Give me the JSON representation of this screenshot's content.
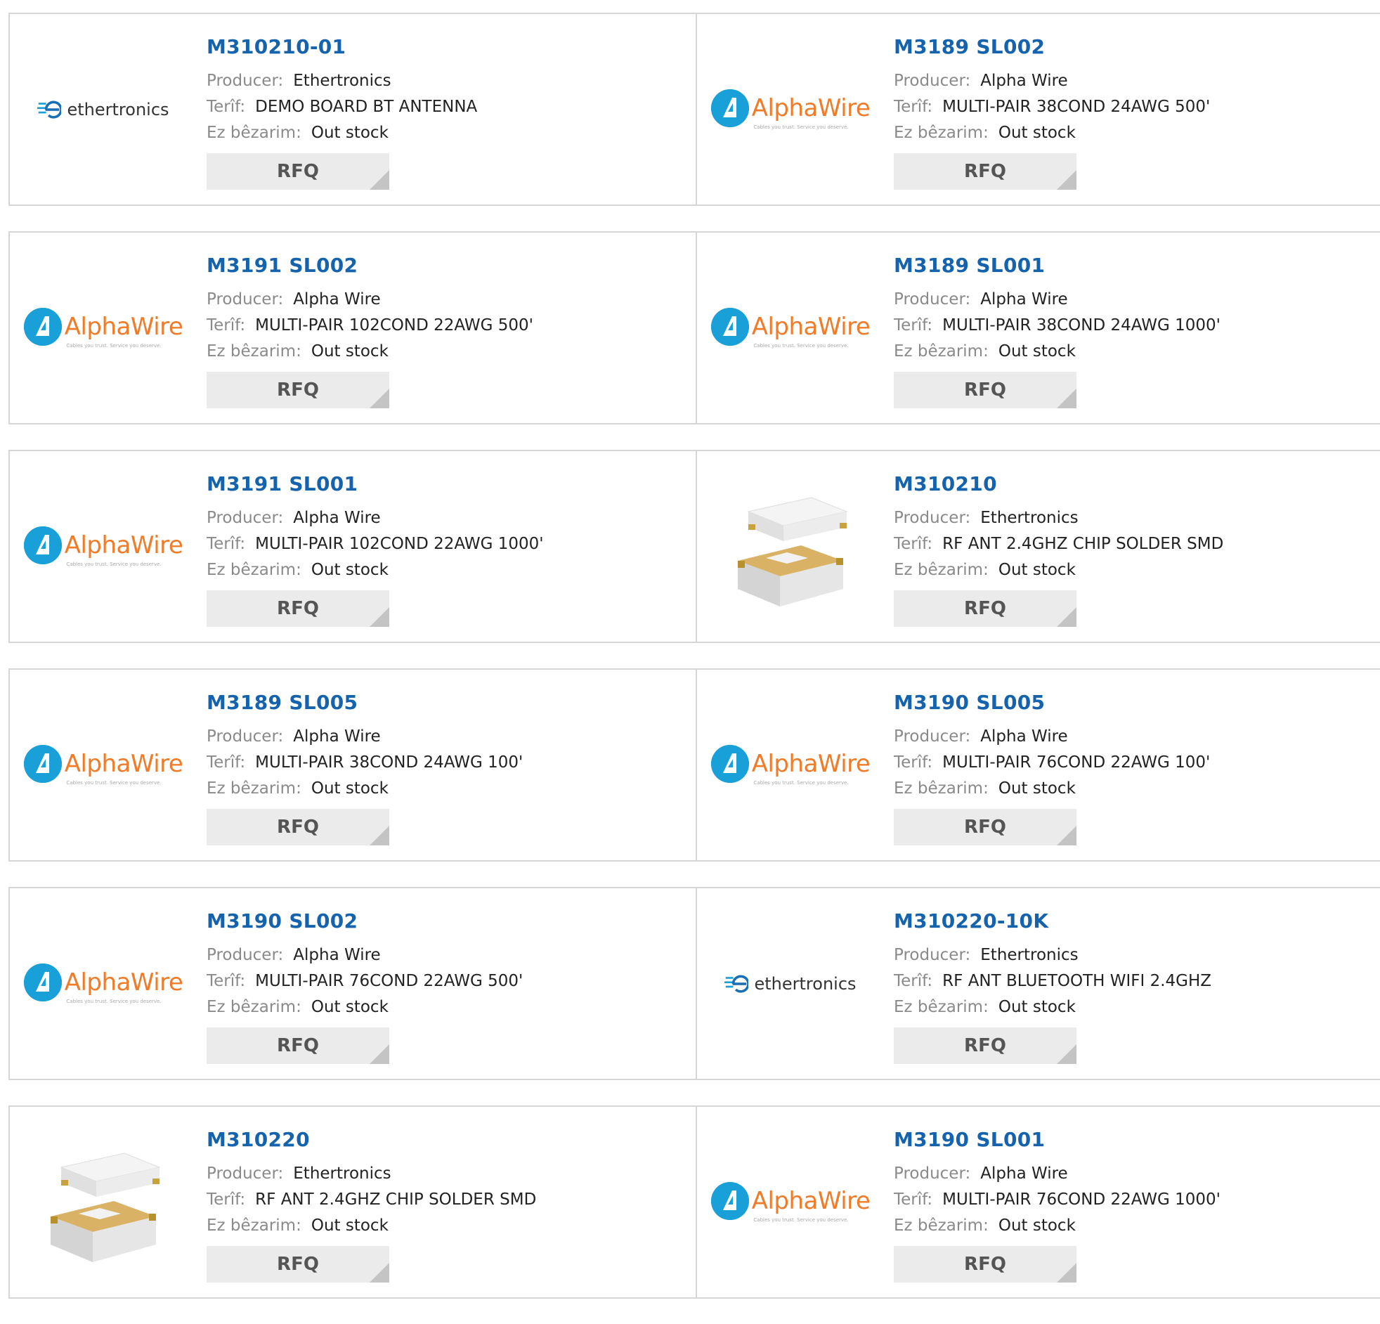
{
  "labels": {
    "producer": "Producer:",
    "description": "Terîf:",
    "stock": "Ez bêzarim:",
    "rfq": "RFQ"
  },
  "products": [
    {
      "part": "M310210-01",
      "producer": "Ethertronics",
      "description": "DEMO BOARD BT ANTENNA",
      "stock": "Out stock",
      "logo": "ethertronics-logo"
    },
    {
      "part": "M3189 SL002",
      "producer": "Alpha Wire",
      "description": "MULTI-PAIR 38COND 24AWG 500'",
      "stock": "Out stock",
      "logo": "alphawire-logo"
    },
    {
      "part": "M3191 SL002",
      "producer": "Alpha Wire",
      "description": "MULTI-PAIR 102COND 22AWG 500'",
      "stock": "Out stock",
      "logo": "alphawire-logo"
    },
    {
      "part": "M3189 SL001",
      "producer": "Alpha Wire",
      "description": "MULTI-PAIR 38COND 24AWG 1000'",
      "stock": "Out stock",
      "logo": "alphawire-logo"
    },
    {
      "part": "M3191 SL001",
      "producer": "Alpha Wire",
      "description": "MULTI-PAIR 102COND 22AWG 1000'",
      "stock": "Out stock",
      "logo": "alphawire-logo"
    },
    {
      "part": "M310210",
      "producer": "Ethertronics",
      "description": "RF ANT 2.4GHZ CHIP SOLDER SMD",
      "stock": "Out stock",
      "logo": "chip-antenna-image"
    },
    {
      "part": "M3189 SL005",
      "producer": "Alpha Wire",
      "description": "MULTI-PAIR 38COND 24AWG 100'",
      "stock": "Out stock",
      "logo": "alphawire-logo"
    },
    {
      "part": "M3190 SL005",
      "producer": "Alpha Wire",
      "description": "MULTI-PAIR 76COND 22AWG 100'",
      "stock": "Out stock",
      "logo": "alphawire-logo"
    },
    {
      "part": "M3190 SL002",
      "producer": "Alpha Wire",
      "description": "MULTI-PAIR 76COND 22AWG 500'",
      "stock": "Out stock",
      "logo": "alphawire-logo"
    },
    {
      "part": "M310220-10K",
      "producer": "Ethertronics",
      "description": "RF ANT BLUETOOTH WIFI 2.4GHZ",
      "stock": "Out stock",
      "logo": "ethertronics-logo"
    },
    {
      "part": "M310220",
      "producer": "Ethertronics",
      "description": "RF ANT 2.4GHZ CHIP SOLDER SMD",
      "stock": "Out stock",
      "logo": "chip-antenna-image"
    },
    {
      "part": "M3190 SL001",
      "producer": "Alpha Wire",
      "description": "MULTI-PAIR 76COND 22AWG 1000'",
      "stock": "Out stock",
      "logo": "alphawire-logo"
    }
  ],
  "logo_text": {
    "ethertronics": "ethertronics",
    "alphawire": "AlphaWire",
    "alphawire_tagline": "Cables you trust. Service you deserve."
  },
  "colors": {
    "title": "#1663ad",
    "label": "#8a8a8a",
    "border": "#d6d6d6",
    "button_bg": "#ebebeb",
    "alpha_blue": "#1aa0d8",
    "alpha_orange": "#f07c2a"
  }
}
